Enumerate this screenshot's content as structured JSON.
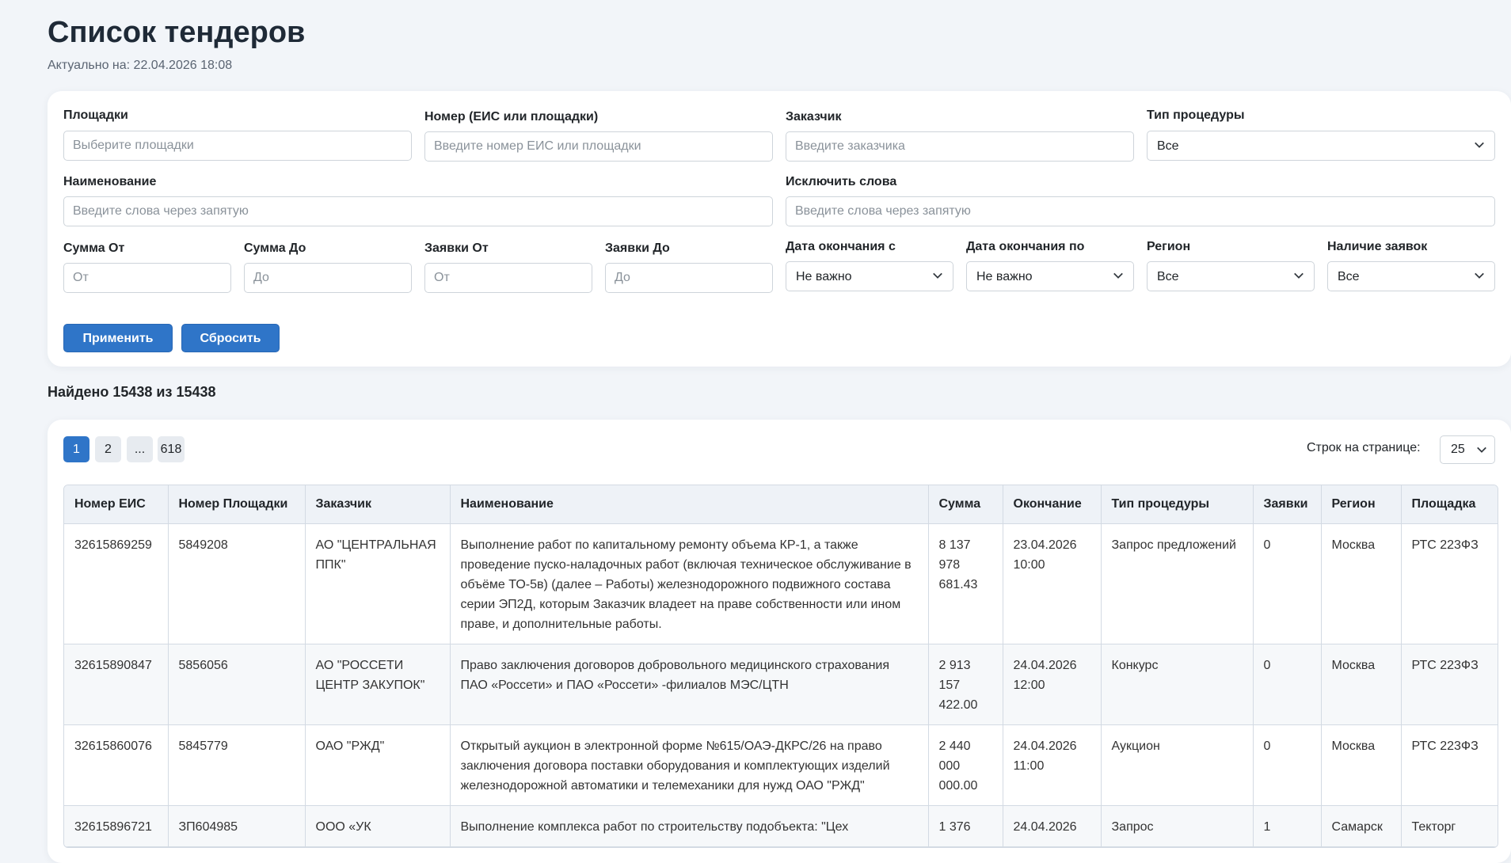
{
  "page": {
    "title": "Список тендеров",
    "updated": "Актуально на: 22.04.2026 18:08"
  },
  "filters": {
    "platforms": {
      "label": "Площадки",
      "placeholder": "Выберите площадки"
    },
    "number": {
      "label": "Номер (ЕИС или площадки)",
      "placeholder": "Введите номер ЕИС или площадки"
    },
    "customer": {
      "label": "Заказчик",
      "placeholder": "Введите заказчика"
    },
    "procedure_type": {
      "label": "Тип процедуры",
      "value": "Все"
    },
    "name": {
      "label": "Наименование",
      "placeholder": "Введите слова через запятую"
    },
    "exclude": {
      "label": "Исключить слова",
      "placeholder": "Введите слова через запятую"
    },
    "sum_from": {
      "label": "Сумма От",
      "placeholder": "От"
    },
    "sum_to": {
      "label": "Сумма До",
      "placeholder": "До"
    },
    "apps_from": {
      "label": "Заявки От",
      "placeholder": "От"
    },
    "apps_to": {
      "label": "Заявки До",
      "placeholder": "До"
    },
    "end_from": {
      "label": "Дата окончания с",
      "value": "Не важно"
    },
    "end_to": {
      "label": "Дата окончания по",
      "value": "Не важно"
    },
    "region": {
      "label": "Регион",
      "value": "Все"
    },
    "has_apps": {
      "label": "Наличие заявок",
      "value": "Все"
    },
    "apply_label": "Применить",
    "reset_label": "Сбросить"
  },
  "results": {
    "found": "Найдено 15438 из 15438",
    "pagination": [
      "1",
      "2",
      "...",
      "618"
    ],
    "active_page": "1",
    "rows_per_page_label": "Строк на странице:",
    "rows_per_page": "25"
  },
  "table": {
    "columns": [
      "Номер ЕИС",
      "Номер Площадки",
      "Заказчик",
      "Наименование",
      "Сумма",
      "Окончание",
      "Тип процедуры",
      "Заявки",
      "Регион",
      "Площадка"
    ],
    "rows": [
      [
        "32615869259",
        "5849208",
        "АО \"ЦЕНТРАЛЬНАЯ ППК\"",
        "Выполнение работ по капитальному ремонту объема КР-1, а также проведение пуско-наладочных работ (включая техническое обслуживание в объёме ТО-5в) (далее – Работы) железнодорожного подвижного состава серии ЭП2Д, которым Заказчик владеет на праве собственности или ином праве, и дополнительные работы.",
        "8 137 978 681.43",
        "23.04.2026 10:00",
        "Запрос предложений",
        "0",
        "Москва",
        "РТС 223ФЗ"
      ],
      [
        "32615890847",
        "5856056",
        "АО \"РОССЕТИ ЦЕНТР ЗАКУПОК\"",
        "Право заключения договоров добровольного медицинского страхования ПАО «Россети» и ПАО «Россети» -филиалов МЭС/ЦТН",
        "2 913 157 422.00",
        "24.04.2026 12:00",
        "Конкурс",
        "0",
        "Москва",
        "РТС 223ФЗ"
      ],
      [
        "32615860076",
        "5845779",
        "ОАО \"РЖД\"",
        "Открытый аукцион в электронной форме №615/ОАЭ-ДКРС/26 на право заключения договора поставки оборудования и комплектующих изделий железнодорожной автоматики и телемеханики для нужд ОАО \"РЖД\"",
        "2 440 000 000.00",
        "24.04.2026 11:00",
        "Аукцион",
        "0",
        "Москва",
        "РТС 223ФЗ"
      ],
      [
        "32615896721",
        "ЗП604985",
        "ООО «УК",
        "Выполнение комплекса работ по строительству подобъекта: \"Цех",
        "1 376",
        "24.04.2026",
        "Запрос",
        "1",
        "Самарск",
        "Текторг"
      ]
    ]
  }
}
